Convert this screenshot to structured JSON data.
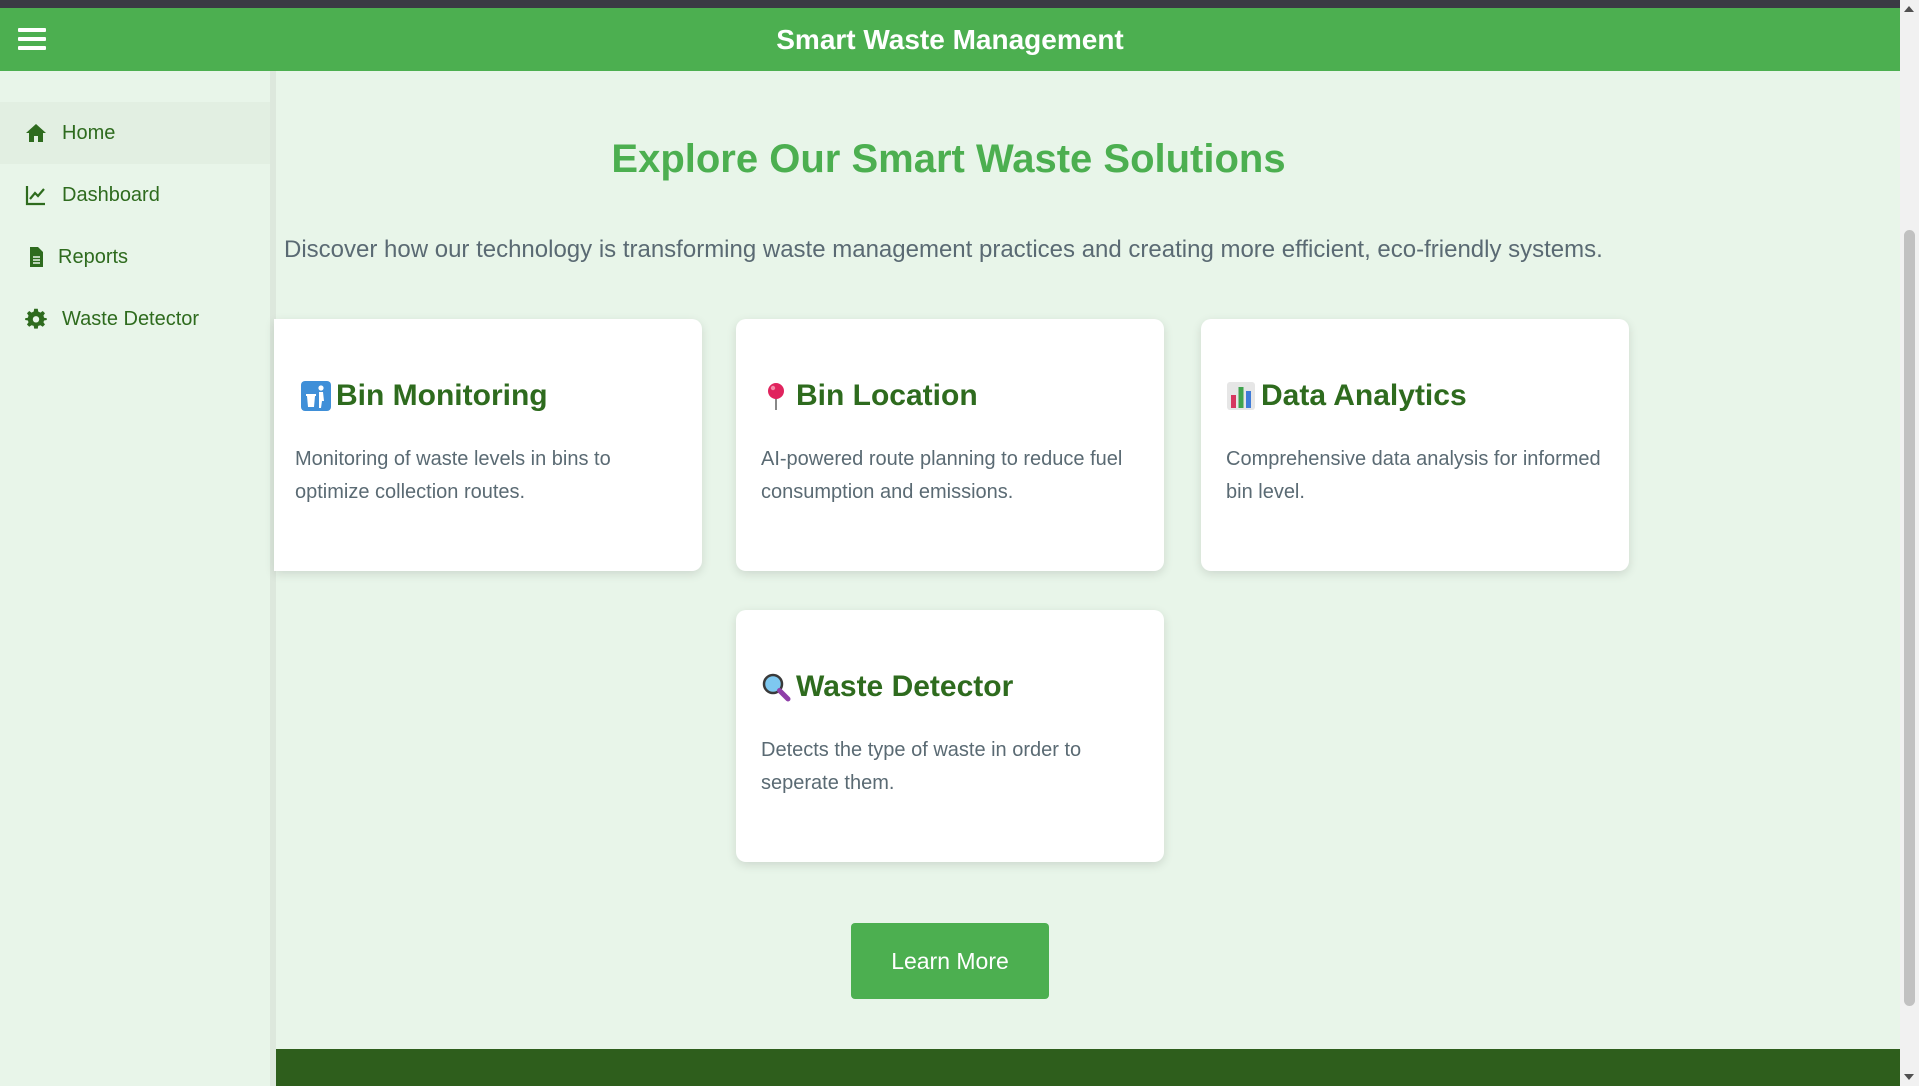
{
  "header": {
    "title": "Smart Waste Management",
    "menu_icon": "hamburger-menu-icon"
  },
  "sidebar": {
    "items": [
      {
        "label": "Home",
        "icon": "home-icon",
        "active": true
      },
      {
        "label": "Dashboard",
        "icon": "line-chart-icon",
        "active": false
      },
      {
        "label": "Reports",
        "icon": "document-icon",
        "active": false
      },
      {
        "label": "Waste Detector",
        "icon": "gear-icon",
        "active": false
      }
    ]
  },
  "main": {
    "title": "Explore Our Smart Waste Solutions",
    "subtitle": "Discover how our technology is transforming waste management practices and creating more efficient, eco-friendly systems.",
    "cards": [
      {
        "title": "Bin Monitoring",
        "icon": "trash-person-icon",
        "description": "Monitoring of waste levels in bins to optimize collection routes."
      },
      {
        "title": "Bin Location",
        "icon": "pin-icon",
        "description": "AI-powered route planning to reduce fuel consumption and emissions."
      },
      {
        "title": "Data Analytics",
        "icon": "bar-chart-icon",
        "description": "Comprehensive data analysis for informed bin level."
      },
      {
        "title": "Waste Detector",
        "icon": "magnifier-icon",
        "description": "Detects the type of waste in order to seperate them."
      }
    ],
    "learn_more_label": "Learn More"
  },
  "colors": {
    "primary": "#4caf50",
    "dark_green": "#2e6b1e",
    "background": "#e8f5e9",
    "footer": "#2e5e1c"
  }
}
